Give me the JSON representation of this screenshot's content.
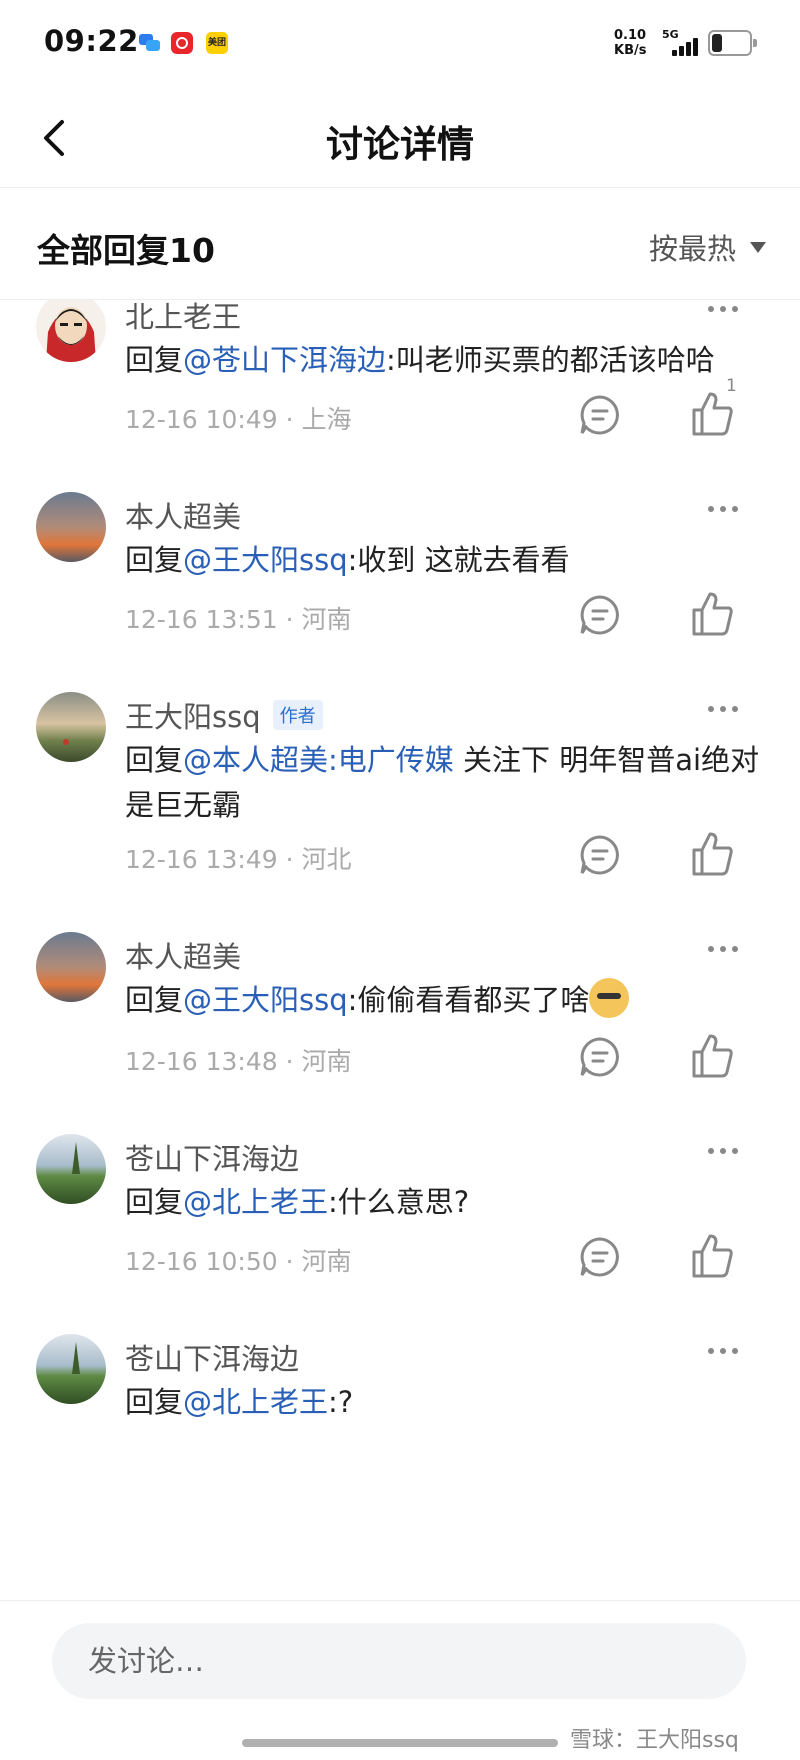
{
  "status_bar": {
    "time": "09:22",
    "app_icons": [
      "messages-icon",
      "pinduoduo-icon",
      "meituan-icon"
    ],
    "meituan_label": "美团",
    "net_speed_value": "0.10",
    "net_speed_unit": "KB/s",
    "network": "5G"
  },
  "header": {
    "title": "讨论详情"
  },
  "sort": {
    "reply_count_label": "全部回复10",
    "sort_label": "按最热"
  },
  "comments": [
    {
      "username": "北上老王",
      "is_author": false,
      "reply_prefix": "回复",
      "mention": "@苍山下洱海边",
      "text": ":叫老师买票的都活该哈哈",
      "time_location": "12-16 10:49 · 上海",
      "likes": "1"
    },
    {
      "username": "本人超美",
      "is_author": false,
      "reply_prefix": "回复",
      "mention": "@王大阳ssq",
      "text": ":收到 这就去看看",
      "time_location": "12-16 13:51 · 河南"
    },
    {
      "username": "王大阳ssq",
      "is_author": true,
      "author_badge": "作者",
      "reply_prefix": "回复",
      "mention": "@本人超美",
      "mention2": ":电广传媒",
      "text": " 关注下 明年智普ai绝对是巨无霸",
      "time_location": "12-16 13:49 · 河北"
    },
    {
      "username": "本人超美",
      "is_author": false,
      "reply_prefix": "回复",
      "mention": "@王大阳ssq",
      "text": ":偷偷看看都买了啥",
      "emoji": "doge-icon",
      "time_location": "12-16 13:48 · 河南"
    },
    {
      "username": "苍山下洱海边",
      "is_author": false,
      "reply_prefix": "回复",
      "mention": "@北上老王",
      "text": ":什么意思?",
      "time_location": "12-16 10:50 · 河南"
    },
    {
      "username": "苍山下洱海边",
      "is_author": false,
      "reply_prefix": "回复",
      "mention": "@北上老王",
      "text": ":?"
    }
  ],
  "bottom": {
    "input_placeholder": "发讨论…",
    "watermark": "雪球：王大阳ssq"
  },
  "colors": {
    "mention": "#2a5fb8",
    "author_badge_text": "#2a6fcf",
    "meta_text": "#aaaaaa"
  }
}
